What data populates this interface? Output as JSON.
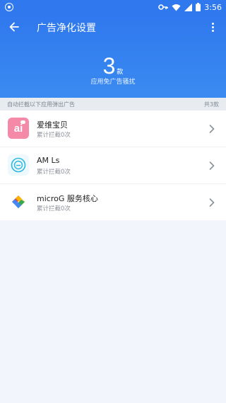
{
  "status_bar": {
    "time": "3:56"
  },
  "appbar": {
    "title": "广告净化设置"
  },
  "summary": {
    "count": "3",
    "unit": "款",
    "description": "应用免广告骚扰"
  },
  "section": {
    "label": "自动拦截以下应用弹出广告",
    "total": "共3款"
  },
  "apps": [
    {
      "name": "爱维宝贝",
      "sub": "累计拦截0次",
      "icon": "ai-icon",
      "icon_text": "ai",
      "icon_color": "#f48aa8"
    },
    {
      "name": "AM Ls",
      "sub": "累计拦截0次",
      "icon": "circle-logo-icon",
      "icon_color": "#2fb7e0"
    },
    {
      "name": "microG 服务核心",
      "sub": "累计拦截0次",
      "icon": "puzzle-icon"
    }
  ],
  "colors": {
    "header": "#2f78ee",
    "background": "#f2f6fc"
  }
}
